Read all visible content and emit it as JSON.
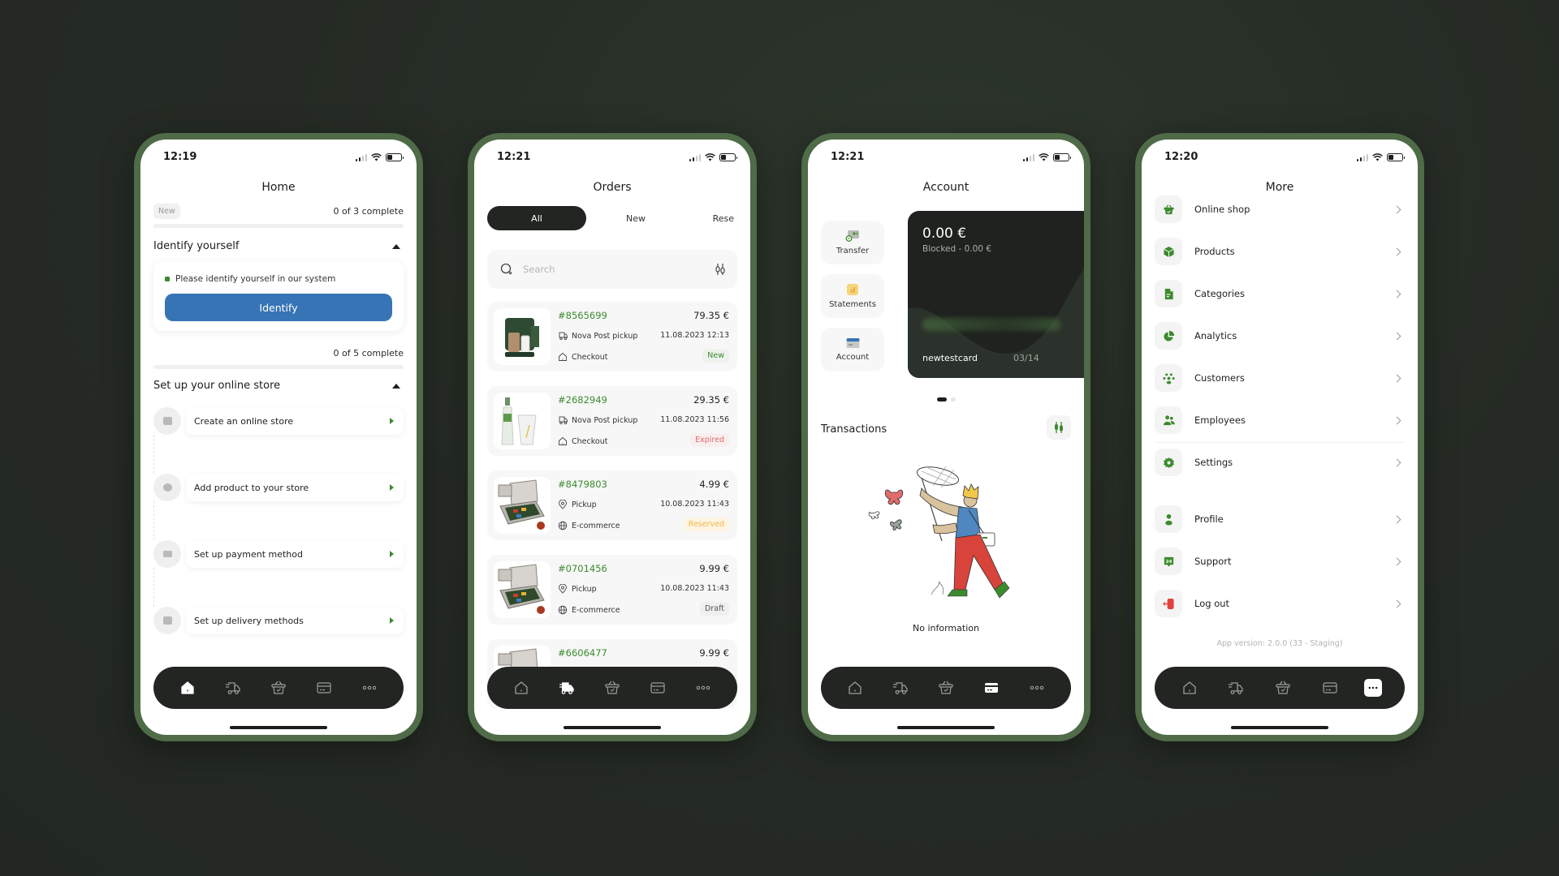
{
  "colors": {
    "background": "#252b24",
    "frame": "#4f6b48",
    "accent_green": "#3c8a2e",
    "primary_blue": "#3674b5",
    "nav_dark": "#222521"
  },
  "bottom_nav": {
    "items": [
      {
        "id": "home",
        "icon": "home-icon"
      },
      {
        "id": "orders",
        "icon": "delivery-truck-icon"
      },
      {
        "id": "shop",
        "icon": "basket-icon"
      },
      {
        "id": "account",
        "icon": "card-icon"
      },
      {
        "id": "more",
        "icon": "more-dots-icon"
      }
    ]
  },
  "home": {
    "time": "12:19",
    "title": "Home",
    "new_chip": "New",
    "identify_progress": "0 of 3 complete",
    "identify_progress_fraction": 0,
    "identify_section_title": "Identify yourself",
    "identify_message": "Please identify yourself in our system",
    "identify_button": "Identify",
    "store_progress": "0 of 5 complete",
    "store_progress_fraction": 0,
    "store_section_title": "Set up your online store",
    "steps": [
      {
        "label": "Create an online store",
        "icon": "store-icon"
      },
      {
        "label": "Add product to your store",
        "icon": "box-icon"
      },
      {
        "label": "Set up payment method",
        "icon": "payment-icon"
      },
      {
        "label": "Set up delivery methods",
        "icon": "delivery-icon"
      }
    ],
    "active_nav": "home"
  },
  "orders": {
    "time": "12:21",
    "title": "Orders",
    "tabs": [
      {
        "label": "All",
        "active": true
      },
      {
        "label": "New",
        "active": false
      },
      {
        "label": "Rese",
        "active": false
      }
    ],
    "search_placeholder": "Search",
    "list": [
      {
        "id": "#8565699",
        "price": "79.35 €",
        "delivery": "Nova Post pickup",
        "date": "11.08.2023 12:13",
        "channel": "Checkout",
        "status": "New",
        "thumb": "coffee-machine"
      },
      {
        "id": "#2682949",
        "price": "29.35 €",
        "delivery": "Nova Post pickup",
        "date": "11.08.2023 11:56",
        "channel": "Checkout",
        "status": "Expired",
        "thumb": "soda-bottle"
      },
      {
        "id": "#8479803",
        "price": "4.99 €",
        "delivery": "Pickup",
        "date": "10.08.2023 11:43",
        "channel": "E-commerce",
        "status": "Reserved",
        "thumb": "tea-box"
      },
      {
        "id": "#0701456",
        "price": "9.99 €",
        "delivery": "Pickup",
        "date": "10.08.2023 11:43",
        "channel": "E-commerce",
        "status": "Draft",
        "thumb": "tea-box"
      },
      {
        "id": "#6606477",
        "price": "9.99 €",
        "thumb": "tea-box"
      }
    ],
    "active_nav": "orders"
  },
  "account": {
    "time": "12:21",
    "title": "Account",
    "actions": [
      {
        "label": "Transfer",
        "icon": "transfer-icon"
      },
      {
        "label": "Statements",
        "icon": "statements-icon"
      },
      {
        "label": "Account",
        "icon": "account-card-icon"
      }
    ],
    "card": {
      "balance": "0.00 €",
      "blocked": "Blocked - 0.00 €",
      "holder": "newtestcard",
      "expiry": "03/14"
    },
    "carousel_pages": 2,
    "carousel_active": 1,
    "transactions_title": "Transactions",
    "empty_text": "No information",
    "active_nav": "account"
  },
  "more": {
    "time": "12:20",
    "title": "More",
    "items": [
      {
        "label": "Online shop",
        "icon": "basket-icon"
      },
      {
        "label": "Products",
        "icon": "box-icon"
      },
      {
        "label": "Categories",
        "icon": "document-icon"
      },
      {
        "label": "Analytics",
        "icon": "pie-chart-icon"
      },
      {
        "label": "Customers",
        "icon": "customers-icon"
      },
      {
        "label": "Employees",
        "icon": "employees-icon"
      },
      {
        "label": "Settings",
        "icon": "gear-icon"
      },
      {
        "label": "Profile",
        "icon": "person-icon"
      },
      {
        "label": "Support",
        "icon": "support-24-icon",
        "badge": "24"
      },
      {
        "label": "Log out",
        "icon": "logout-icon"
      }
    ],
    "app_version": "App version:  2.0.0 (33 - Staging)",
    "active_nav": "more"
  }
}
